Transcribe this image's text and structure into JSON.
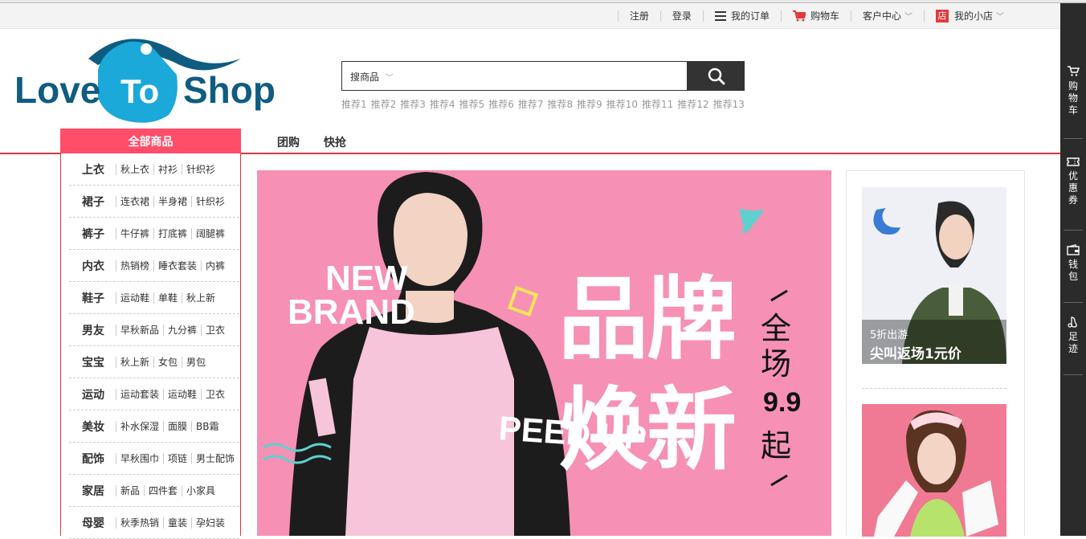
{
  "topbar": {
    "register": "注册",
    "login": "登录",
    "my_orders": "我的订单",
    "cart": "购物车",
    "customer_center": "客户中心",
    "shop_badge": "店",
    "my_shop": "我的小店"
  },
  "logo": {
    "text_left": "Love",
    "text_mid": "To",
    "text_right": "Shop"
  },
  "search": {
    "category": "搜商品",
    "placeholder": "",
    "hot_words": [
      "推荐1",
      "推荐2",
      "推荐3",
      "推荐4",
      "推荐5",
      "推荐6",
      "推荐7",
      "推荐8",
      "推荐9",
      "推荐10",
      "推荐11",
      "推荐12",
      "推荐13"
    ]
  },
  "nav": {
    "all_categories": "全部商品",
    "links": [
      "团购",
      "快抢"
    ]
  },
  "categories": [
    {
      "name": "上衣",
      "subs": [
        "秋上衣",
        "衬衫",
        "针织衫"
      ]
    },
    {
      "name": "裙子",
      "subs": [
        "连衣裙",
        "半身裙",
        "针织衫"
      ]
    },
    {
      "name": "裤子",
      "subs": [
        "牛仔裤",
        "打底裤",
        "阔腿裤"
      ]
    },
    {
      "name": "内衣",
      "subs": [
        "热销榜",
        "睡衣套装",
        "内裤"
      ]
    },
    {
      "name": "鞋子",
      "subs": [
        "运动鞋",
        "单鞋",
        "秋上新"
      ]
    },
    {
      "name": "男友",
      "subs": [
        "早秋新品",
        "九分裤",
        "卫衣"
      ]
    },
    {
      "name": "宝宝",
      "subs": [
        "秋上新",
        "女包",
        "男包"
      ]
    },
    {
      "name": "运动",
      "subs": [
        "运动套装",
        "运动鞋",
        "卫衣"
      ]
    },
    {
      "name": "美妆",
      "subs": [
        "补水保湿",
        "面膜",
        "BB霜"
      ]
    },
    {
      "name": "配饰",
      "subs": [
        "早秋围巾",
        "项链",
        "男士配饰"
      ]
    },
    {
      "name": "家居",
      "subs": [
        "新品",
        "四件套",
        "小家具"
      ]
    },
    {
      "name": "母婴",
      "subs": [
        "秋季热销",
        "童装",
        "孕妇装"
      ]
    }
  ],
  "banner": {
    "brand_line1": "NEW",
    "brand_line2": "BRAND",
    "headline1": "品牌",
    "headline2": "焕新",
    "side1": "全",
    "side2": "场",
    "price": "9.9",
    "side3": "起",
    "shirt_text": "PEED UP",
    "colors": {
      "background": "#f690b4",
      "jacket": "#1c1c1c"
    }
  },
  "promos": [
    {
      "line1": "5折出游",
      "line2": "尖叫返场1元价"
    }
  ],
  "right_sidebar": [
    {
      "label": "购物车",
      "icon": "cart-icon"
    },
    {
      "label": "优惠券",
      "icon": "coupon-icon"
    },
    {
      "label": "钱包",
      "icon": "wallet-icon"
    },
    {
      "label": "足迹",
      "icon": "footprint-icon"
    }
  ],
  "colors": {
    "accent": "#ff4d6a",
    "nav_line": "#d9363e",
    "dark": "#333333"
  }
}
